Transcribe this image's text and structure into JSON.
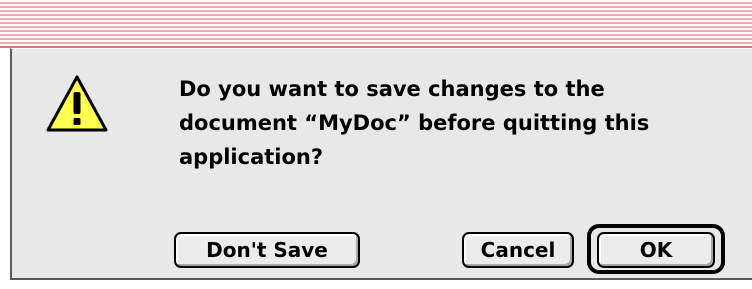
{
  "dialog": {
    "message": "Do you want to save changes to the document “MyDoc” before quitting this application?",
    "icon": "caution-icon",
    "buttons": {
      "dont_save": "Don't Save",
      "cancel": "Cancel",
      "ok": "OK"
    },
    "default_button": "ok",
    "colors": {
      "titlebar_stripe": "#f0a8a8",
      "body_background": "#e8e8e8",
      "icon_fill": "#ffff4f"
    }
  }
}
